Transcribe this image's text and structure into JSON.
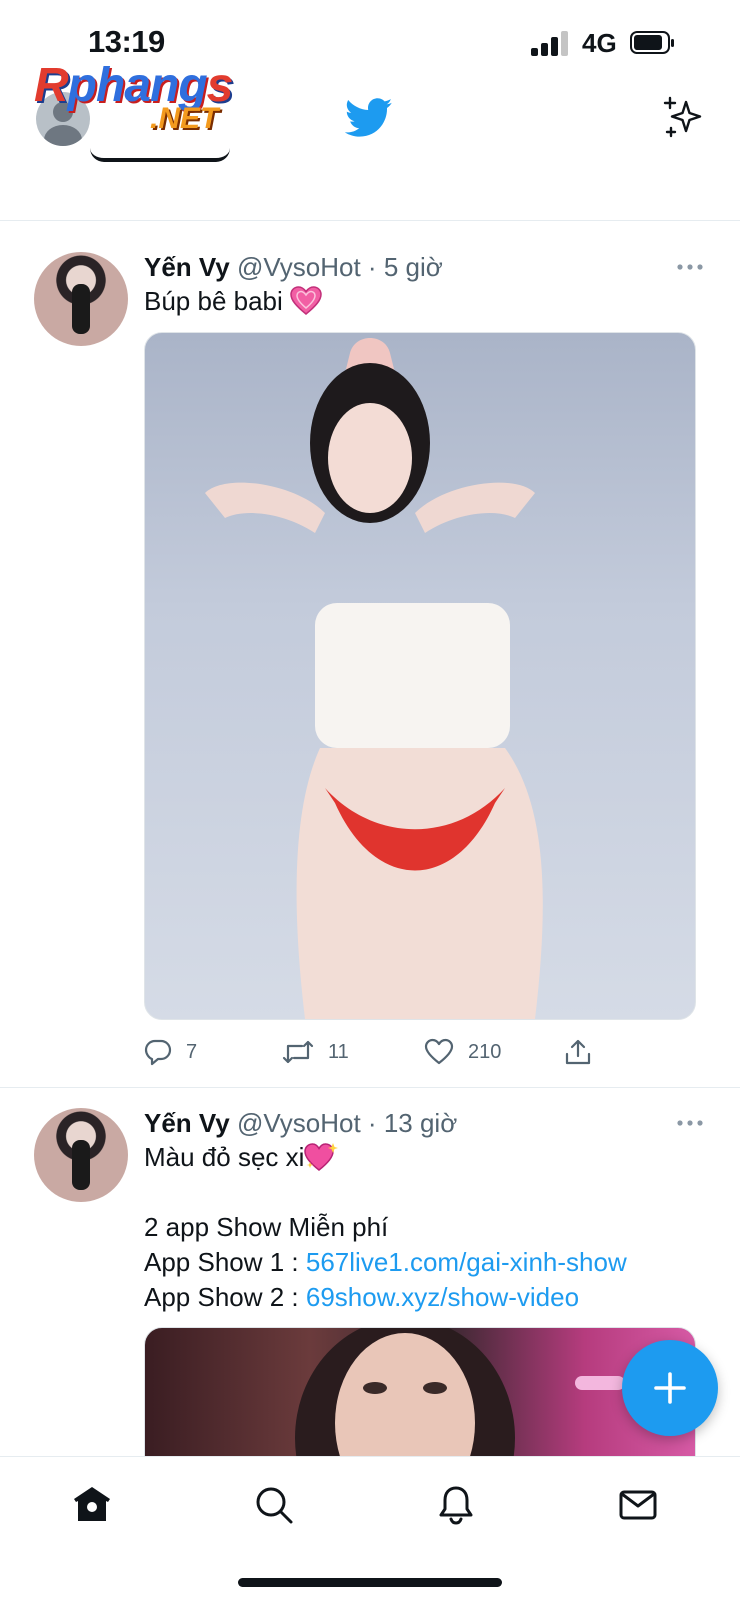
{
  "status_bar": {
    "time": "13:19",
    "network": "4G",
    "signal_bars_active": 3,
    "signal_bars_total": 4,
    "battery_level": 0.8
  },
  "watermark": {
    "line1_part1": "R",
    "line1_part2": "phang",
    "line1_part3": "s",
    "line2": ".NET"
  },
  "header": {
    "logo_icon": "twitter-bird-icon",
    "right_icon": "sparkle-icon",
    "accent_color": "#1d9bf0"
  },
  "tweets": [
    {
      "name": "Yến Vy",
      "handle": "@VysoHot",
      "dot": "·",
      "ago": "5 giờ",
      "text": "Búp bê babi",
      "emoji": "pink-heart",
      "replies": "7",
      "retweets": "11",
      "likes": "210"
    },
    {
      "name": "Yến Vy",
      "handle": "@VysoHot",
      "dot": "·",
      "ago": "13 giờ",
      "text": "Màu đỏ sẹc xi",
      "emoji": "sparkling-heart",
      "line2": "2 app Show Miễn phí",
      "line3_prefix": "App Show 1 : ",
      "line3_link": "567live1.com/gai-xinh-show",
      "line4_prefix": "App Show 2 : ",
      "line4_link": "69show.xyz/show-video"
    }
  ],
  "tab_bar": {
    "items": [
      "home-icon",
      "search-icon",
      "notifications-icon",
      "messages-icon"
    ]
  },
  "fab": {
    "icon": "plus-icon"
  }
}
